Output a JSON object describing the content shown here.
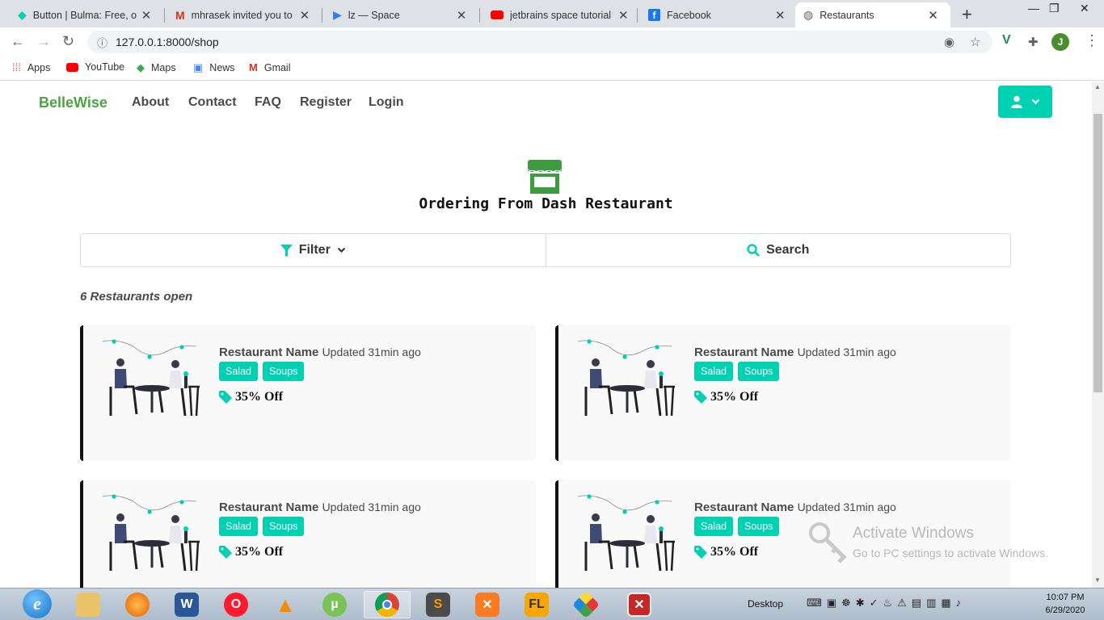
{
  "browser": {
    "tabs": [
      {
        "title": "Button | Bulma: Free, ope",
        "icon": "bulma-icon",
        "color": "#00d1b2"
      },
      {
        "title": "mhrasek invited you to jo",
        "icon": "gmail-icon",
        "color": "#d93025"
      },
      {
        "title": "lz — Space",
        "icon": "space-icon",
        "color": "#2f80ed"
      },
      {
        "title": "jetbrains space tutorial -",
        "icon": "youtube-icon",
        "color": "#ff0000"
      },
      {
        "title": "Facebook",
        "icon": "facebook-icon",
        "color": "#1877f2"
      },
      {
        "title": "Restaurants",
        "icon": "globe-icon",
        "color": "#5f6368"
      }
    ],
    "active_tab": 5,
    "url": "127.0.0.1:8000/shop",
    "profile_initial": "J",
    "bookmarks": [
      {
        "label": "Apps",
        "icon": "apps-grid-icon"
      },
      {
        "label": "YouTube",
        "icon": "youtube-icon"
      },
      {
        "label": "Maps",
        "icon": "maps-icon"
      },
      {
        "label": "News",
        "icon": "news-icon"
      },
      {
        "label": "Gmail",
        "icon": "gmail-icon"
      }
    ]
  },
  "site": {
    "brand": "BelleWise",
    "nav": [
      "About",
      "Contact",
      "FAQ",
      "Register",
      "Login"
    ],
    "accent": "#00d1b2",
    "brand_color": "#48a53f"
  },
  "page": {
    "title": "Ordering From Dash Restaurant",
    "filter_label": "Filter",
    "search_label": "Search",
    "open_count": "6 Restaurants open"
  },
  "restaurants": [
    {
      "name": "Restaurant Name",
      "updated": "Updated 31min ago",
      "tags": [
        "Salad",
        "Soups"
      ],
      "discount": "35% Off"
    },
    {
      "name": "Restaurant Name",
      "updated": "Updated 31min ago",
      "tags": [
        "Salad",
        "Soups"
      ],
      "discount": "35% Off"
    },
    {
      "name": "Restaurant Name",
      "updated": "Updated 31min ago",
      "tags": [
        "Salad",
        "Soups"
      ],
      "discount": "35% Off"
    },
    {
      "name": "Restaurant Name",
      "updated": "Updated 31min ago",
      "tags": [
        "Salad",
        "Soups"
      ],
      "discount": "35% Off"
    }
  ],
  "watermark": {
    "title": "Activate Windows",
    "subtitle": "Go to PC settings to activate Windows."
  },
  "taskbar": {
    "apps": [
      "internet-explorer",
      "file-explorer",
      "firefox",
      "word",
      "opera",
      "vlc",
      "utorrent",
      "chrome",
      "sublime-text",
      "xampp",
      "fl-studio",
      "git-kraken",
      "media-app"
    ],
    "active_app": "chrome",
    "desktop_label": "Desktop",
    "time": "10:07 PM",
    "date": "6/29/2020"
  }
}
